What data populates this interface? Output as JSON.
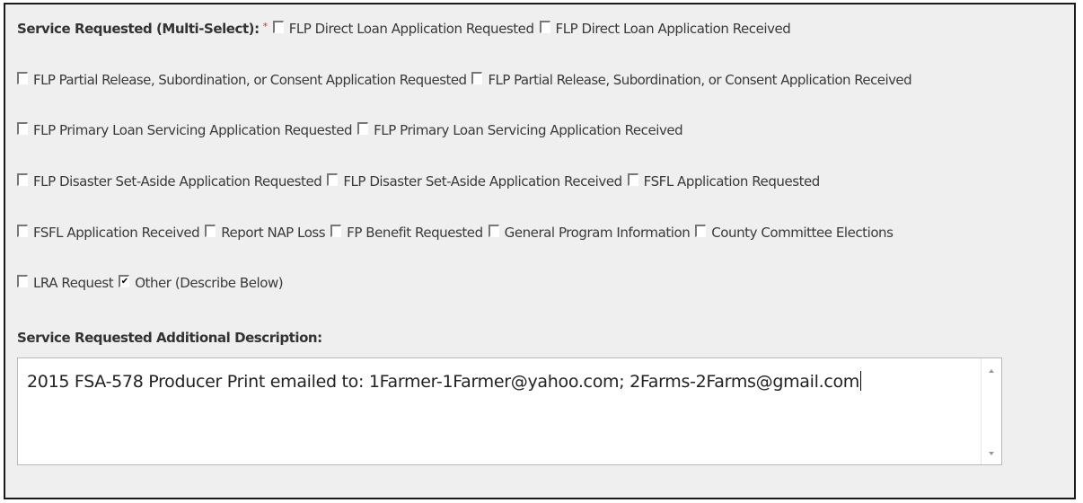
{
  "form": {
    "service_label": "Service Requested (Multi-Select):",
    "required_marker": "*",
    "rows": [
      [
        {
          "label": "FLP Direct Loan Application Requested",
          "checked": false
        },
        {
          "label": "FLP Direct Loan Application Received",
          "checked": false
        }
      ],
      [
        {
          "label": "FLP Partial Release, Subordination, or Consent Application Requested",
          "checked": false
        },
        {
          "label": "FLP Partial Release, Subordination, or Consent Application Received",
          "checked": false
        }
      ],
      [
        {
          "label": "FLP Primary Loan Servicing Application Requested",
          "checked": false
        },
        {
          "label": "FLP Primary Loan Servicing Application Received",
          "checked": false
        }
      ],
      [
        {
          "label": "FLP Disaster Set-Aside Application Requested",
          "checked": false
        },
        {
          "label": "FLP Disaster Set-Aside Application Received",
          "checked": false
        },
        {
          "label": "FSFL Application Requested",
          "checked": false
        }
      ],
      [
        {
          "label": "FSFL Application Received",
          "checked": false
        },
        {
          "label": "Report NAP Loss",
          "checked": false
        },
        {
          "label": "FP Benefit Requested",
          "checked": false
        },
        {
          "label": "General Program Information",
          "checked": false
        },
        {
          "label": "County Committee Elections",
          "checked": false
        }
      ],
      [
        {
          "label": "LRA Request",
          "checked": false
        },
        {
          "label": "Other (Describe Below)",
          "checked": true
        }
      ]
    ],
    "check_glyph": "✔",
    "description_label": "Service Requested Additional Description:",
    "description_value": "2015 FSA-578 Producer Print emailed to:  1Farmer-1Farmer@yahoo.com; 2Farms-2Farms@gmail.com"
  },
  "colors": {
    "panel_bg": "#efefef",
    "required": "#c0392b",
    "border": "#1a1a1a"
  },
  "icons": {
    "checkbox": "checkbox-icon",
    "scroll_up": "scroll-up-arrow-icon",
    "scroll_down": "scroll-down-arrow-icon"
  }
}
